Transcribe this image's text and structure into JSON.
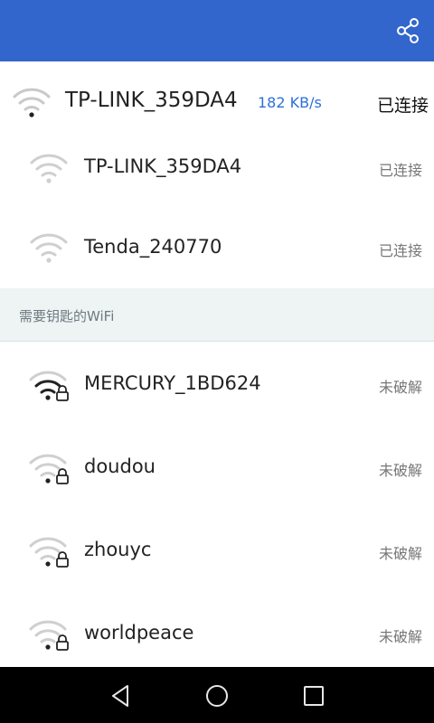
{
  "connected": {
    "ssid": "TP-LINK_359DA4",
    "speed": "182 KB/s",
    "status": "已连接"
  },
  "saved_networks": [
    {
      "ssid": "TP-LINK_359DA4",
      "status": "已连接"
    },
    {
      "ssid": "Tenda_240770",
      "status": "已连接"
    }
  ],
  "locked_section": {
    "title": "需要钥匙的WiFi",
    "networks": [
      {
        "ssid": "MERCURY_1BD624",
        "status": "未破解",
        "signal_bars": 3
      },
      {
        "ssid": "doudou",
        "status": "未破解",
        "signal_bars": 1
      },
      {
        "ssid": "zhouyc",
        "status": "未破解",
        "signal_bars": 1
      },
      {
        "ssid": "worldpeace",
        "status": "未破解",
        "signal_bars": 1
      }
    ]
  },
  "icons": {
    "share": "share-icon",
    "wifi": "wifi-icon",
    "lock": "lock-icon",
    "back": "back-icon",
    "home": "home-icon",
    "recents": "recents-icon"
  },
  "colors": {
    "appbar": "#3366cc",
    "speed_text": "#2e6fd9",
    "section_bg": "#eef3f4"
  }
}
